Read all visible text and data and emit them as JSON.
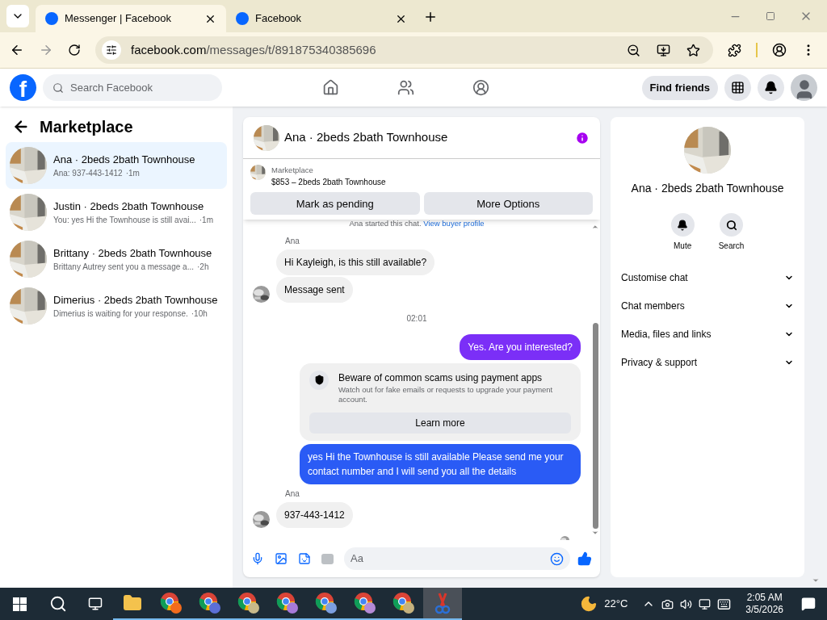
{
  "browser": {
    "tabs": [
      {
        "title": "Messenger | Facebook",
        "selected": true
      },
      {
        "title": "Facebook",
        "selected": false
      }
    ],
    "url_host": "facebook.com",
    "url_path": "/messages/t/891875340385696"
  },
  "facebook": {
    "logo": "f",
    "search_placeholder": "Search Facebook",
    "find_friends": "Find friends"
  },
  "sidebar": {
    "title": "Marketplace",
    "conversations": [
      {
        "name": "Ana · 2beds 2bath Townhouse",
        "preview": "Ana: 937-443-1412",
        "time": "·1m",
        "selected": true
      },
      {
        "name": "Justin · 2beds 2bath Townhouse",
        "preview": "You: yes Hi the Townhouse is still avai...",
        "time": "·1m",
        "selected": false
      },
      {
        "name": "Brittany · 2beds 2bath Townhouse",
        "preview": "Brittany Autrey sent you a message a...",
        "time": "·2h",
        "selected": false
      },
      {
        "name": "Dimerius · 2beds 2bath Townhouse",
        "preview": "Dimerius is waiting for your response.",
        "time": "·10h",
        "selected": false
      }
    ]
  },
  "chat": {
    "title": "Ana · 2beds 2bath Townhouse",
    "listing": {
      "source": "Marketplace",
      "title": "$853 – 2beds 2bath Townhouse"
    },
    "actions": [
      "Mark as pending",
      "More Options"
    ],
    "intro": {
      "text": "Ana started this chat.",
      "link": "View buyer profile"
    },
    "messages": [
      {
        "kind": "incoming",
        "sender": "Ana",
        "texts": [
          "Hi Kayleigh, is this still available?",
          "Message sent"
        ]
      },
      {
        "kind": "time",
        "text": "02:01"
      },
      {
        "kind": "outgoing",
        "text": "Yes. Are you interested?",
        "color": "#7b2ff7"
      },
      {
        "kind": "notice",
        "title": "Beware of common scams using payment apps",
        "body": "Watch out for fake emails or requests to upgrade your payment account.",
        "button": "Learn more"
      },
      {
        "kind": "outgoing",
        "text": "yes Hi the Townhouse is still available Please send me your contact number and I will send you all the details",
        "color": "#2a5bf5"
      },
      {
        "kind": "incoming",
        "sender": "Ana",
        "texts": [
          "937-443-1412"
        ]
      }
    ],
    "composer_placeholder": "Aa"
  },
  "info": {
    "name": "Ana · 2beds 2bath Townhouse",
    "actions": [
      {
        "kind": "mute",
        "label": "Mute"
      },
      {
        "kind": "search",
        "label": "Search"
      }
    ],
    "sections": [
      "Customise chat",
      "Chat members",
      "Media, files and links",
      "Privacy & support"
    ]
  },
  "taskbar": {
    "apps": [
      {
        "kind": "explorer",
        "selected": false
      },
      {
        "kind": "chrome",
        "color": "#f26b1d",
        "selected": false
      },
      {
        "kind": "chrome",
        "color": "#5b6fd6",
        "selected": false
      },
      {
        "kind": "chrome",
        "color": "#c9b98a",
        "selected": false
      },
      {
        "kind": "chrome",
        "color": "#a77ad9",
        "selected": false
      },
      {
        "kind": "chrome",
        "color": "#7c9fe0",
        "selected": false
      },
      {
        "kind": "chrome",
        "color": "#b58ad6",
        "selected": false
      },
      {
        "kind": "chrome",
        "color": "#c5b27e",
        "selected": false
      },
      {
        "kind": "snip",
        "selected": true
      }
    ],
    "weather": "22°C",
    "time": "2:05 AM",
    "date": "3/5/2026"
  }
}
